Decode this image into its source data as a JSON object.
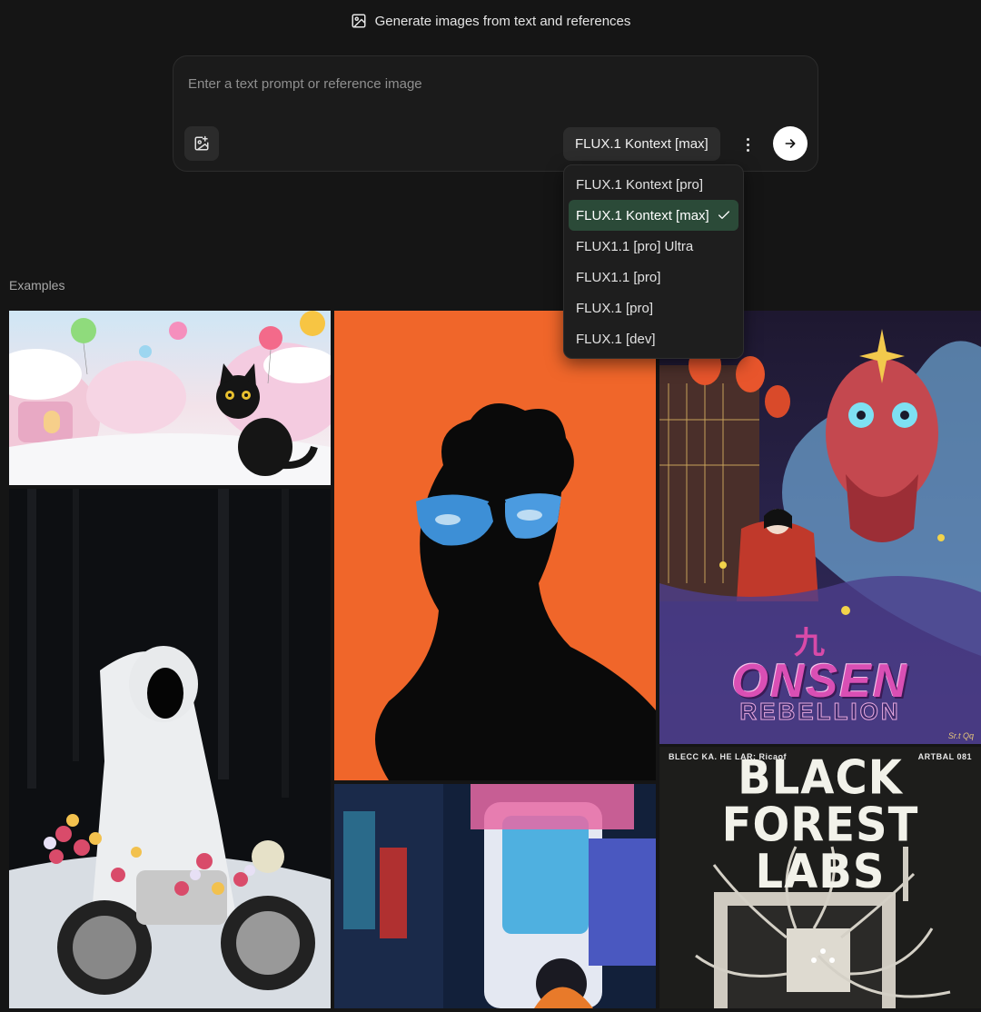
{
  "header": {
    "icon": "image-icon",
    "title": "Generate images from text and references"
  },
  "prompt": {
    "placeholder": "Enter a text prompt or reference image",
    "value": "",
    "upload_icon": "image-plus-icon",
    "more_icon": "more-vertical-icon",
    "send_icon": "arrow-right-icon"
  },
  "model_selector": {
    "selected": "FLUX.1 Kontext [max]",
    "options": [
      "FLUX.1 Kontext [pro]",
      "FLUX.1 Kontext [max]",
      "FLUX1.1 [pro] Ultra",
      "FLUX1.1 [pro]",
      "FLUX.1 [pro]",
      "FLUX.1 [dev]"
    ],
    "selected_index": 1,
    "check_icon": "check-icon"
  },
  "examples": {
    "label": "Examples",
    "posters": {
      "onsen_glyph": "九",
      "onsen_title": "ONSEN",
      "onsen_subtitle": "REBELLION",
      "onsen_signature": "Sr.t Qq",
      "bfl_top_left": "BLECC KA. HE LAR: Ricaof",
      "bfl_top_right": "ARTBAL 081",
      "bfl_title_line1": "BLACK FOREST",
      "bfl_title_line2": "LABS"
    }
  },
  "colors": {
    "background": "#151515",
    "panel": "#1b1b1b",
    "selected_option": "#2b4a38",
    "send_button": "#ffffff"
  }
}
